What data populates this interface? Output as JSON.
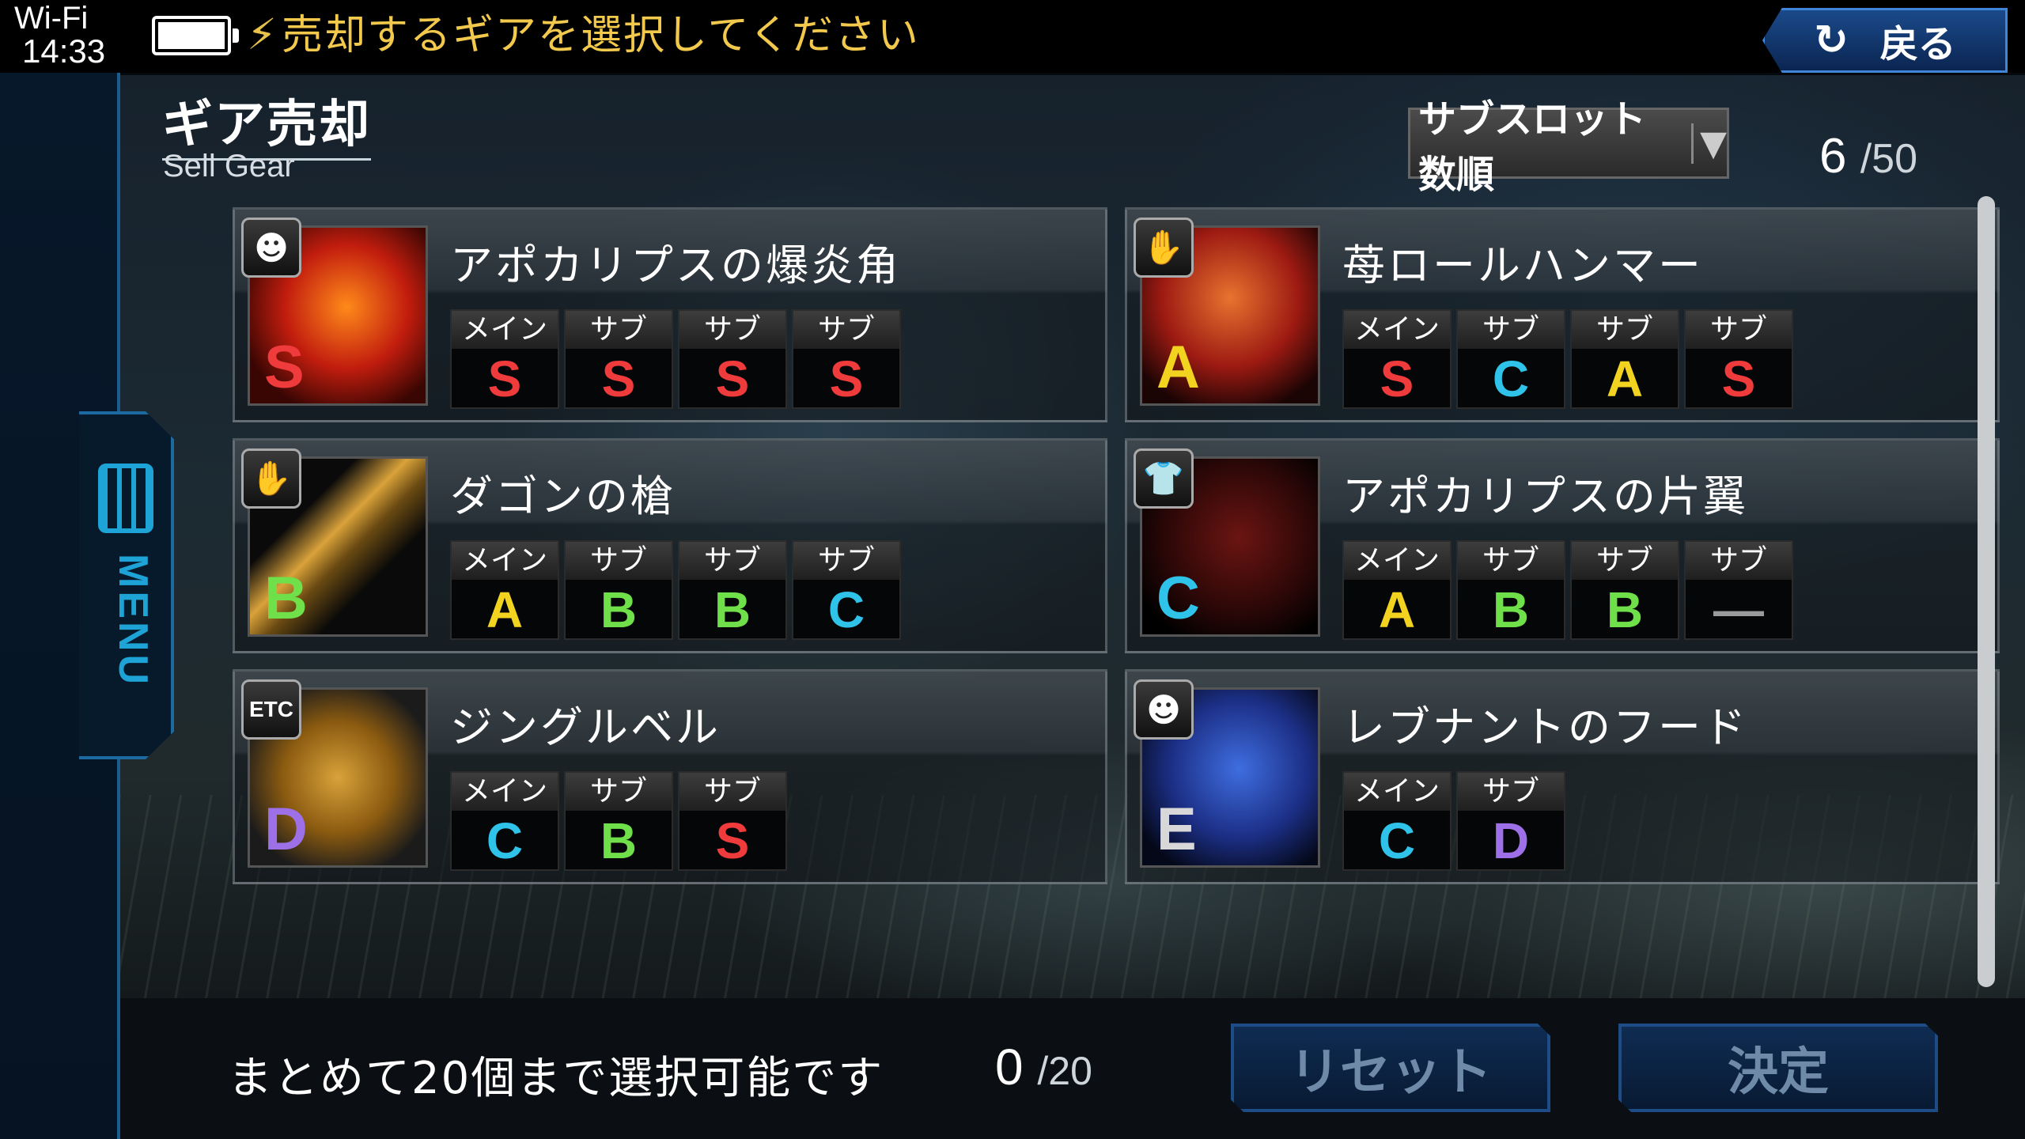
{
  "status_bar": {
    "network": "Wi-Fi",
    "time": "14:33",
    "instruction": "売却するギアを選択してください"
  },
  "back_button": {
    "icon": "↻",
    "label": "戻る"
  },
  "menu": {
    "label": "MENU"
  },
  "header": {
    "title": "ギア売却",
    "subtitle": "Sell Gear"
  },
  "sort": {
    "selected": "サブスロット数順",
    "arrow": "▼"
  },
  "inventory": {
    "current": "6",
    "max": "/50"
  },
  "gears": [
    {
      "name": "アポカリプスの爆炎角",
      "type_icon": "head-icon",
      "type_glyph": "☻",
      "rank": "S",
      "slots": [
        {
          "label": "メイン",
          "rank": "S"
        },
        {
          "label": "サブ",
          "rank": "S"
        },
        {
          "label": "サブ",
          "rank": "S"
        },
        {
          "label": "サブ",
          "rank": "S"
        }
      ]
    },
    {
      "name": "苺ロールハンマー",
      "type_icon": "hand-icon",
      "type_glyph": "✋",
      "rank": "A",
      "slots": [
        {
          "label": "メイン",
          "rank": "S"
        },
        {
          "label": "サブ",
          "rank": "C"
        },
        {
          "label": "サブ",
          "rank": "A"
        },
        {
          "label": "サブ",
          "rank": "S"
        }
      ]
    },
    {
      "name": "ダゴンの槍",
      "type_icon": "hand-icon",
      "type_glyph": "✋",
      "rank": "B",
      "slots": [
        {
          "label": "メイン",
          "rank": "A"
        },
        {
          "label": "サブ",
          "rank": "B"
        },
        {
          "label": "サブ",
          "rank": "B"
        },
        {
          "label": "サブ",
          "rank": "C"
        }
      ]
    },
    {
      "name": "アポカリプスの片翼",
      "type_icon": "body-icon",
      "type_glyph": "👕",
      "rank": "C",
      "slots": [
        {
          "label": "メイン",
          "rank": "A"
        },
        {
          "label": "サブ",
          "rank": "B"
        },
        {
          "label": "サブ",
          "rank": "B"
        },
        {
          "label": "サブ",
          "rank": "—"
        }
      ]
    },
    {
      "name": "ジングルベル",
      "type_icon": "etc-icon",
      "type_glyph": "ETC",
      "rank": "D",
      "slots": [
        {
          "label": "メイン",
          "rank": "C"
        },
        {
          "label": "サブ",
          "rank": "B"
        },
        {
          "label": "サブ",
          "rank": "S"
        }
      ]
    },
    {
      "name": "レブナントのフード",
      "type_icon": "head-icon",
      "type_glyph": "☻",
      "rank": "E",
      "slots": [
        {
          "label": "メイン",
          "rank": "C"
        },
        {
          "label": "サブ",
          "rank": "D"
        }
      ]
    }
  ],
  "footer": {
    "note": "まとめて20個まで選択可能です",
    "selected": "0",
    "selected_max": "/20",
    "reset_label": "リセット",
    "confirm_label": "決定"
  },
  "colors": {
    "S": "#ef3b3b",
    "A": "#f2d31f",
    "B": "#6fe04a",
    "C": "#2fc3ea",
    "D": "#9d70e8",
    "E": "#d8d8d8",
    "accent": "#1ea3d6",
    "instruction": "#f2c94c"
  }
}
